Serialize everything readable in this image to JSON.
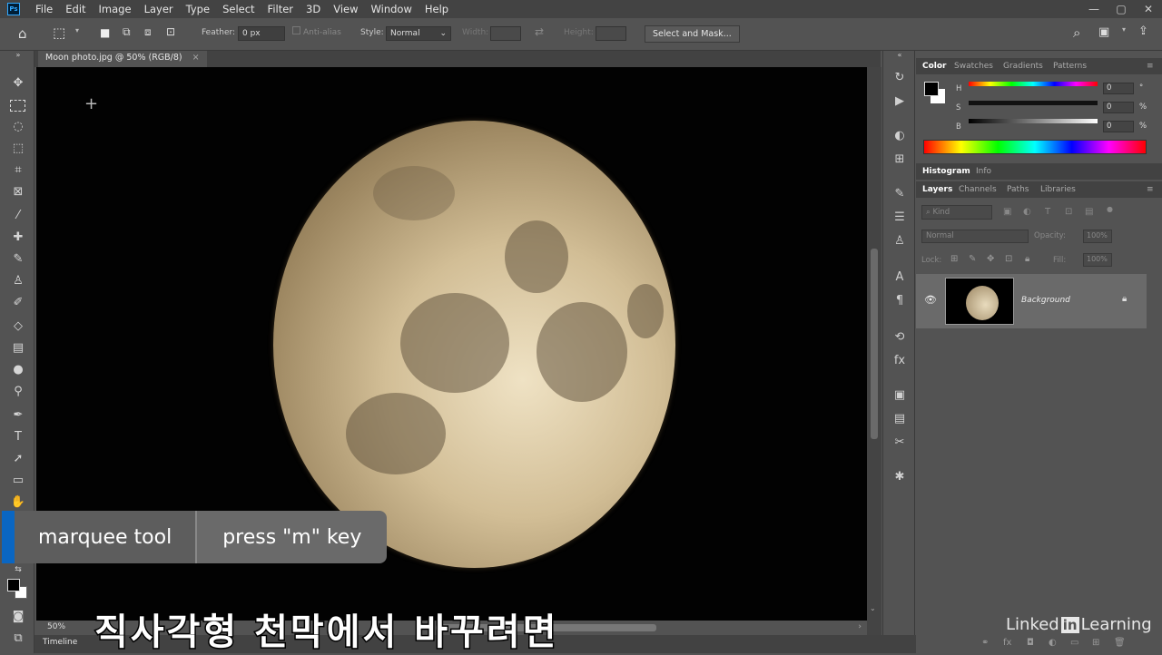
{
  "menu": {
    "app_logo": "Ps",
    "items": [
      "File",
      "Edit",
      "Image",
      "Layer",
      "Type",
      "Select",
      "Filter",
      "3D",
      "View",
      "Window",
      "Help"
    ],
    "window_controls": [
      "—",
      "▢",
      "✕"
    ]
  },
  "options": {
    "feather_label": "Feather:",
    "feather_value": "0 px",
    "antialias_label": "Anti-alias",
    "style_label": "Style:",
    "style_value": "Normal",
    "width_label": "Width:",
    "height_label": "Height:",
    "select_mask_label": "Select and Mask..."
  },
  "document": {
    "tab_title": "Moon photo.jpg @ 50% (RGB/8)",
    "zoom": "50%"
  },
  "timeline_label": "Timeline",
  "color_panel": {
    "tabs": [
      "Color",
      "Swatches",
      "Gradients",
      "Patterns"
    ],
    "h_label": "H",
    "s_label": "S",
    "b_label": "B",
    "h_value": "0",
    "s_value": "0",
    "b_value": "0",
    "h_unit": "°",
    "s_unit": "%",
    "b_unit": "%"
  },
  "histogram_tabs": [
    "Histogram",
    "Info"
  ],
  "layers_panel": {
    "tabs": [
      "Layers",
      "Channels",
      "Paths",
      "Libraries"
    ],
    "kind_placeholder": "Kind",
    "blend_mode": "Normal",
    "opacity_label": "Opacity:",
    "opacity_value": "100%",
    "lock_label": "Lock:",
    "fill_label": "Fill:",
    "fill_value": "100%",
    "layer_name": "Background"
  },
  "caption": {
    "tool": "marquee tool",
    "shortcut": "press \"m\" key"
  },
  "subtitle": "직사각형 천막에서 바꾸려면",
  "watermark": {
    "left": "Linked",
    "in": "in",
    "right": "Learning"
  }
}
